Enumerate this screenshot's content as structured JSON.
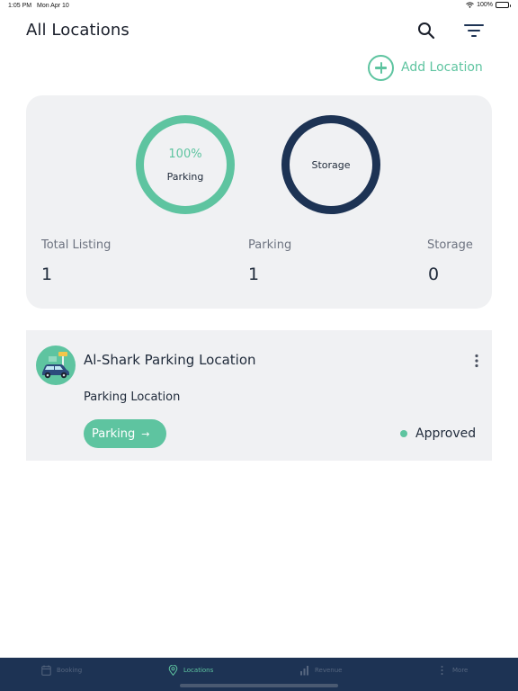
{
  "status_bar": {
    "time": "1:05 PM",
    "date": "Mon Apr 10",
    "battery": "100%"
  },
  "header": {
    "title": "All Locations",
    "search_icon": "search-icon",
    "filter_icon": "filter-icon"
  },
  "add_location": {
    "label": "Add Location"
  },
  "summary": {
    "parking_ring": {
      "percent": "100%",
      "label": "Parking"
    },
    "storage_ring": {
      "label": "Storage"
    },
    "stats": [
      {
        "label": "Total Listing",
        "value": "1"
      },
      {
        "label": "Parking",
        "value": "1"
      },
      {
        "label": "Storage",
        "value": "0"
      }
    ]
  },
  "locations": [
    {
      "title": "Al-Shark Parking Location",
      "subtitle": "Parking Location",
      "type_button": "Parking",
      "arrow": "→",
      "status": "Approved"
    }
  ],
  "bottom_nav": [
    {
      "label": "Booking",
      "icon": "calendar-icon",
      "active": false
    },
    {
      "label": "Locations",
      "icon": "location-pin-icon",
      "active": true
    },
    {
      "label": "Revenue",
      "icon": "bar-chart-icon",
      "active": false
    },
    {
      "label": "More",
      "icon": "more-vertical-icon",
      "active": false
    }
  ],
  "colors": {
    "accent": "#5ec4a0",
    "navy": "#1d3354",
    "card_bg": "#f0f1f3"
  }
}
